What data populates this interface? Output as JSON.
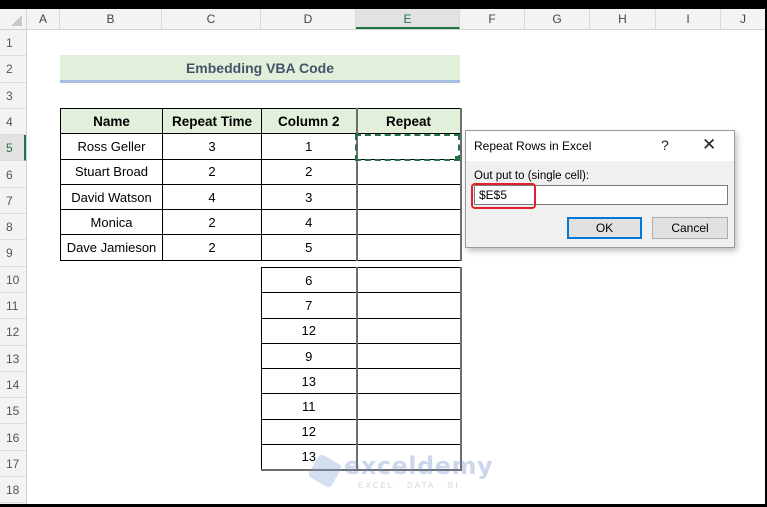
{
  "sheet": {
    "columns": [
      "A",
      "B",
      "C",
      "D",
      "E",
      "F",
      "G",
      "H",
      "I",
      "J"
    ],
    "selected_column": "E",
    "rows": [
      "1",
      "2",
      "3",
      "4",
      "5",
      "6",
      "7",
      "8",
      "9",
      "10",
      "11",
      "12",
      "13",
      "14",
      "15",
      "16",
      "17",
      "18"
    ],
    "selected_row": "5",
    "selected_cell": "E5"
  },
  "banner": {
    "title": "Embedding VBA Code"
  },
  "table": {
    "headers": [
      "Name",
      "Repeat Time",
      "Column 2",
      "Repeat"
    ],
    "rows": [
      {
        "name": "Ross Geller",
        "repeat_time": "3",
        "column2": "1",
        "repeat": ""
      },
      {
        "name": "Stuart Broad",
        "repeat_time": "2",
        "column2": "2",
        "repeat": ""
      },
      {
        "name": "David Watson",
        "repeat_time": "4",
        "column2": "3",
        "repeat": ""
      },
      {
        "name": "Monica",
        "repeat_time": "2",
        "column2": "4",
        "repeat": ""
      },
      {
        "name": "Dave Jamieson",
        "repeat_time": "2",
        "column2": "5",
        "repeat": ""
      }
    ],
    "extra_column2": [
      "6",
      "7",
      "12",
      "9",
      "13",
      "11",
      "12",
      "13"
    ]
  },
  "dialog": {
    "title": "Repeat Rows in Excel",
    "help_icon": "?",
    "close_icon": "✕",
    "label": "Out put to (single cell):",
    "input_value": "$E$5",
    "ok_label": "OK",
    "cancel_label": "Cancel"
  },
  "watermark": {
    "name": "exceldemy",
    "tagline": "EXCEL · DATA · BI"
  },
  "colors": {
    "accent_green": "#217346",
    "header_fill": "#e2efda",
    "highlight_red": "#e0202a",
    "ok_border": "#0078d7"
  }
}
